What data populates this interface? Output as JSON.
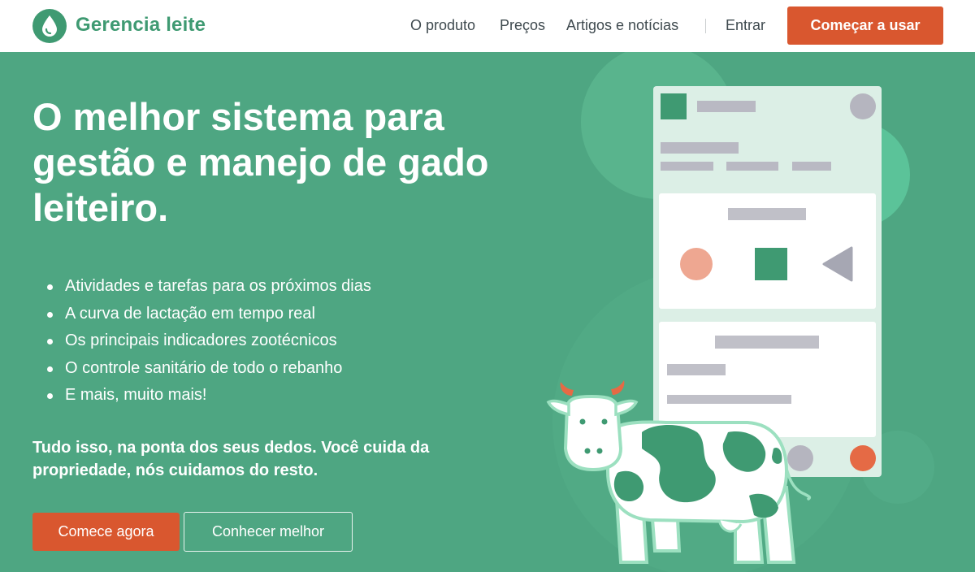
{
  "header": {
    "brand": "Gerencia leite",
    "nav": [
      "O produto",
      "Preços",
      "Artigos e notícias"
    ],
    "login": "Entrar",
    "cta": "Começar a usar"
  },
  "hero": {
    "title": "O melhor sistema para gestão e manejo de gado leiteiro.",
    "features": [
      "Atividades e tarefas para os próximos dias",
      "A curva de lactação em tempo real",
      "Os principais indicadores zootécnicos",
      "O controle sanitário de todo o rebanho",
      "E mais, muito mais!"
    ],
    "tagline": "Tudo isso, na ponta dos seus dedos. Você cuida da propriedade, nós cuidamos do resto.",
    "primary_button": "Comece agora",
    "secondary_button": "Conhecer melhor"
  },
  "colors": {
    "brand_green": "#3f9a72",
    "hero_background": "#4ea682",
    "accent_orange": "#d9572f"
  },
  "icons": {
    "logo": "milk-drop-icon",
    "list_bullet": "bullet-dot-icon"
  }
}
